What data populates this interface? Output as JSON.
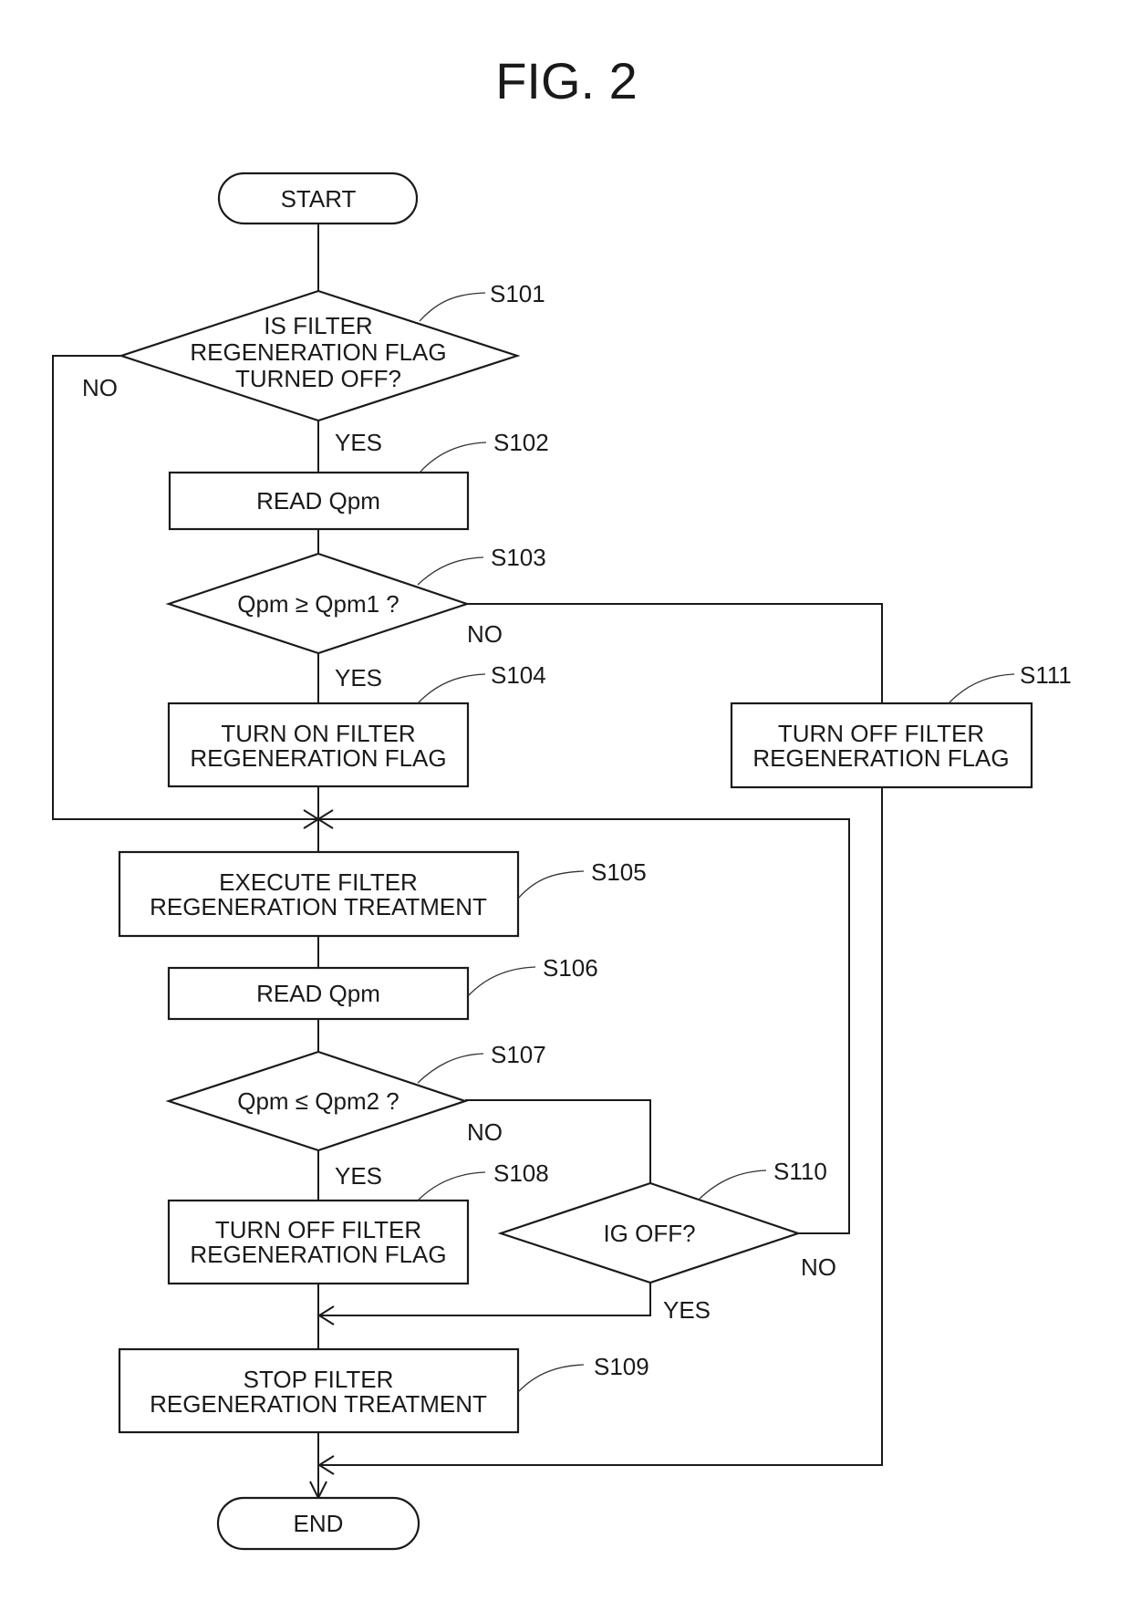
{
  "figure": {
    "title": "FIG. 2"
  },
  "terminals": {
    "start": "START",
    "end": "END"
  },
  "steps": {
    "S101": {
      "id": "S101",
      "type": "decision",
      "lines": [
        "IS FILTER",
        "REGENERATION FLAG",
        "TURNED OFF?"
      ],
      "yes": "YES",
      "no": "NO"
    },
    "S102": {
      "id": "S102",
      "type": "process",
      "lines": [
        "READ Qpm"
      ]
    },
    "S103": {
      "id": "S103",
      "type": "decision",
      "lines": [
        "Qpm ≥ Qpm1 ?"
      ],
      "yes": "YES",
      "no": "NO"
    },
    "S104": {
      "id": "S104",
      "type": "process",
      "lines": [
        "TURN ON FILTER",
        "REGENERATION FLAG"
      ]
    },
    "S105": {
      "id": "S105",
      "type": "process",
      "lines": [
        "EXECUTE FILTER",
        "REGENERATION TREATMENT"
      ]
    },
    "S106": {
      "id": "S106",
      "type": "process",
      "lines": [
        "READ Qpm"
      ]
    },
    "S107": {
      "id": "S107",
      "type": "decision",
      "lines": [
        "Qpm ≤ Qpm2 ?"
      ],
      "yes": "YES",
      "no": "NO"
    },
    "S108": {
      "id": "S108",
      "type": "process",
      "lines": [
        "TURN OFF FILTER",
        "REGENERATION FLAG"
      ]
    },
    "S109": {
      "id": "S109",
      "type": "process",
      "lines": [
        "STOP FILTER",
        "REGENERATION TREATMENT"
      ]
    },
    "S110": {
      "id": "S110",
      "type": "decision",
      "lines": [
        "IG OFF?"
      ],
      "yes": "YES",
      "no": "NO"
    },
    "S111": {
      "id": "S111",
      "type": "process",
      "lines": [
        "TURN OFF FILTER",
        "REGENERATION FLAG"
      ]
    }
  },
  "edges": [
    {
      "from": "START",
      "to": "S101"
    },
    {
      "from": "S101",
      "to": "S102",
      "label": "YES"
    },
    {
      "from": "S101",
      "to": "S105",
      "label": "NO"
    },
    {
      "from": "S102",
      "to": "S103"
    },
    {
      "from": "S103",
      "to": "S104",
      "label": "YES"
    },
    {
      "from": "S103",
      "to": "S111",
      "label": "NO"
    },
    {
      "from": "S104",
      "to": "S105"
    },
    {
      "from": "S105",
      "to": "S106"
    },
    {
      "from": "S106",
      "to": "S107"
    },
    {
      "from": "S107",
      "to": "S108",
      "label": "YES"
    },
    {
      "from": "S107",
      "to": "S110",
      "label": "NO"
    },
    {
      "from": "S110",
      "to": "S109",
      "label": "YES"
    },
    {
      "from": "S110",
      "to": "S105",
      "label": "NO"
    },
    {
      "from": "S108",
      "to": "S109"
    },
    {
      "from": "S109",
      "to": "END"
    },
    {
      "from": "S111",
      "to": "END"
    }
  ]
}
